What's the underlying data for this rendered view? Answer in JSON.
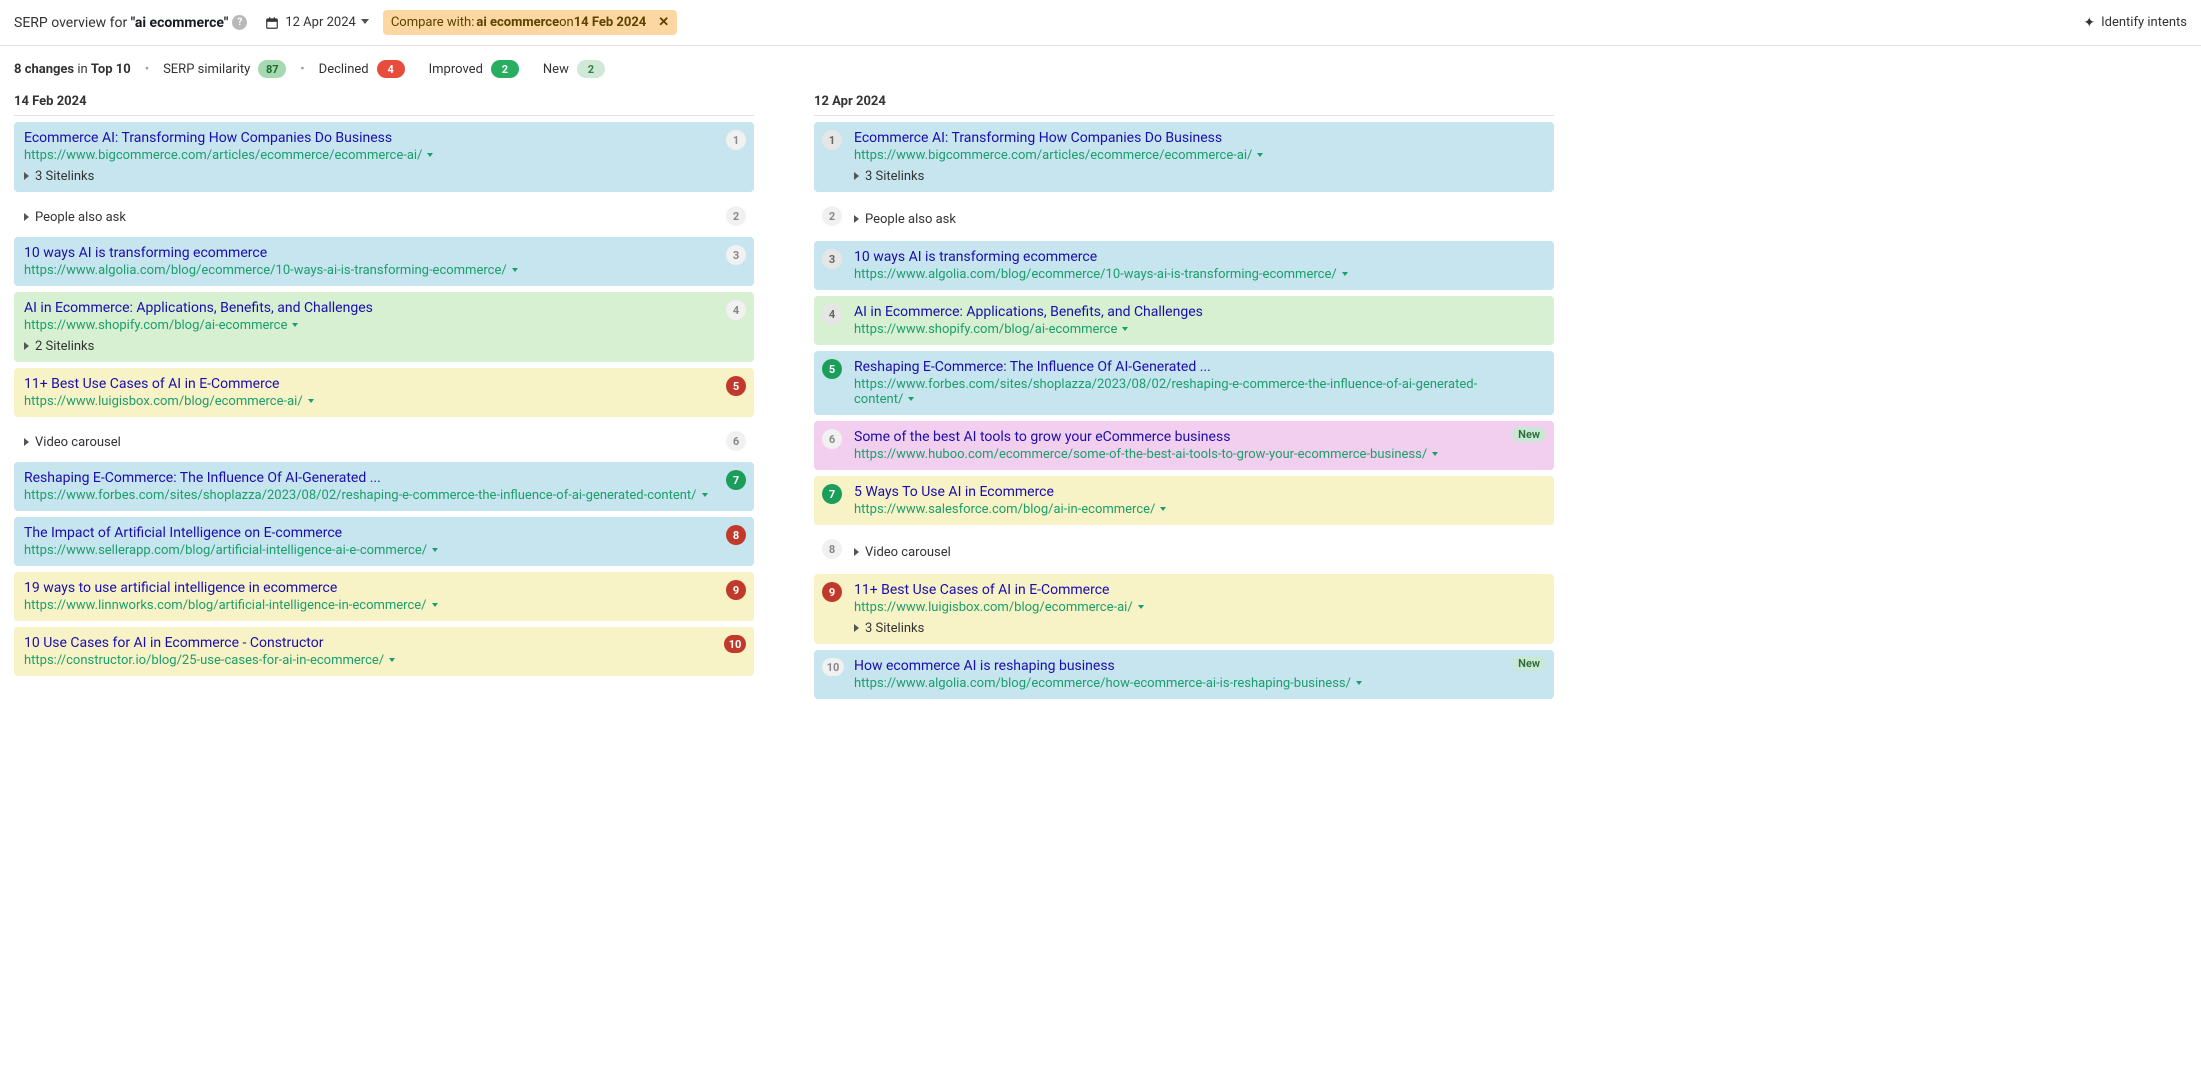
{
  "header": {
    "title_prefix": "SERP overview for ",
    "title_query": "\"ai ecommerce\"",
    "date": "12 Apr 2024",
    "compare_prefix": "Compare with: ",
    "compare_term": "ai ecommerce",
    "compare_on": " on ",
    "compare_date": "14 Feb 2024",
    "identify": "Identify intents"
  },
  "summary": {
    "changes_count": "8 changes",
    "changes_in": " in ",
    "changes_scope": "Top 10",
    "similarity_label": "SERP similarity",
    "similarity_value": "87",
    "declined_label": "Declined",
    "declined_value": "4",
    "improved_label": "Improved",
    "improved_value": "2",
    "new_label": "New",
    "new_value": "2"
  },
  "left_date": "14 Feb 2024",
  "right_date": "12 Apr 2024",
  "left": [
    {
      "rank": "1",
      "rank_style": "plain",
      "bg": "bg-blue",
      "title": "Ecommerce AI: Transforming How Companies Do Business",
      "url": "https://www.bigcommerce.com/articles/ecommerce/ecommerce-ai/",
      "expander": "3 Sitelinks"
    },
    {
      "rank": "2",
      "rank_style": "plain",
      "bg": "bg-none",
      "expander": "People also ask"
    },
    {
      "rank": "3",
      "rank_style": "plain",
      "bg": "bg-blue",
      "title": "10 ways AI is transforming ecommerce",
      "url": "https://www.algolia.com/blog/ecommerce/10-ways-ai-is-transforming-ecommerce/"
    },
    {
      "rank": "4",
      "rank_style": "plain",
      "bg": "bg-green",
      "title": "AI in Ecommerce: Applications, Benefits, and Challenges",
      "url": "https://www.shopify.com/blog/ai-ecommerce",
      "expander": "2 Sitelinks"
    },
    {
      "rank": "5",
      "rank_style": "down",
      "bg": "bg-yellow",
      "title": "11+ Best Use Cases of AI in E-Commerce",
      "url": "https://www.luigisbox.com/blog/ecommerce-ai/"
    },
    {
      "rank": "6",
      "rank_style": "plain",
      "bg": "bg-none",
      "expander": "Video carousel"
    },
    {
      "rank": "7",
      "rank_style": "up",
      "bg": "bg-blue",
      "title": "Reshaping E-Commerce: The Influence Of AI-Generated ...",
      "url": "https://www.forbes.com/sites/shoplazza/2023/08/02/reshaping-e-commerce-the-influence-of-ai-generated-content/"
    },
    {
      "rank": "8",
      "rank_style": "down",
      "bg": "bg-blue",
      "title": "The Impact of Artificial Intelligence on E-commerce",
      "url": "https://www.sellerapp.com/blog/artificial-intelligence-ai-e-commerce/"
    },
    {
      "rank": "9",
      "rank_style": "down",
      "bg": "bg-yellow",
      "title": "19 ways to use artificial intelligence in ecommerce",
      "url": "https://www.linnworks.com/blog/artificial-intelligence-in-ecommerce/"
    },
    {
      "rank": "10",
      "rank_style": "down",
      "bg": "bg-yellow",
      "title": "10 Use Cases for AI in Ecommerce - Constructor",
      "url": "https://constructor.io/blog/25-use-cases-for-ai-in-ecommerce/"
    }
  ],
  "right": [
    {
      "rank": "1",
      "rank_style": "same",
      "bg": "bg-blue",
      "title": "Ecommerce AI: Transforming How Companies Do Business",
      "url": "https://www.bigcommerce.com/articles/ecommerce/ecommerce-ai/",
      "expander": "3 Sitelinks"
    },
    {
      "rank": "2",
      "rank_style": "plain",
      "bg": "bg-none",
      "expander": "People also ask"
    },
    {
      "rank": "3",
      "rank_style": "same",
      "bg": "bg-blue",
      "title": "10 ways AI is transforming ecommerce",
      "url": "https://www.algolia.com/blog/ecommerce/10-ways-ai-is-transforming-ecommerce/"
    },
    {
      "rank": "4",
      "rank_style": "same",
      "bg": "bg-green",
      "title": "AI in Ecommerce: Applications, Benefits, and Challenges",
      "url": "https://www.shopify.com/blog/ai-ecommerce"
    },
    {
      "rank": "5",
      "rank_style": "up",
      "bg": "bg-blue",
      "title": "Reshaping E-Commerce: The Influence Of AI-Generated ...",
      "url": "https://www.forbes.com/sites/shoplazza/2023/08/02/reshaping-e-commerce-the-influence-of-ai-generated-content/"
    },
    {
      "rank": "6",
      "rank_style": "plain",
      "bg": "bg-pink",
      "title": "Some of the best AI tools to grow your eCommerce business",
      "url": "https://www.huboo.com/ecommerce/some-of-the-best-ai-tools-to-grow-your-ecommerce-business/",
      "new": "New"
    },
    {
      "rank": "7",
      "rank_style": "up",
      "bg": "bg-yellow",
      "title": "5 Ways To Use AI in Ecommerce",
      "url": "https://www.salesforce.com/blog/ai-in-ecommerce/"
    },
    {
      "rank": "8",
      "rank_style": "plain",
      "bg": "bg-none",
      "expander": "Video carousel"
    },
    {
      "rank": "9",
      "rank_style": "down",
      "bg": "bg-yellow",
      "title": "11+ Best Use Cases of AI in E-Commerce",
      "url": "https://www.luigisbox.com/blog/ecommerce-ai/",
      "expander": "3 Sitelinks"
    },
    {
      "rank": "10",
      "rank_style": "plain",
      "bg": "bg-blue",
      "title": "How ecommerce AI is reshaping business",
      "url": "https://www.algolia.com/blog/ecommerce/how-ecommerce-ai-is-reshaping-business/",
      "new": "New"
    }
  ]
}
